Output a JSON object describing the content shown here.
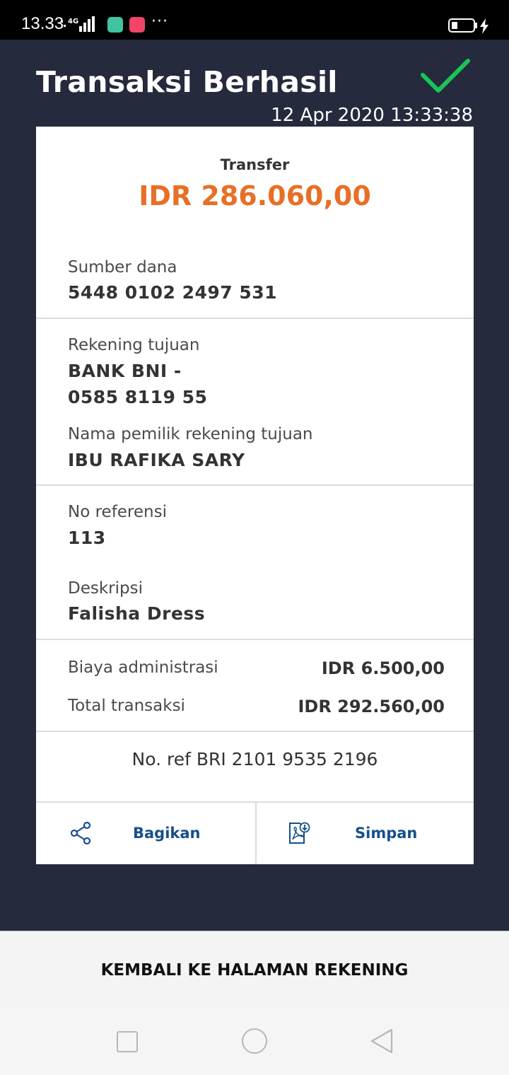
{
  "status_bar": {
    "time": "13.33",
    "network": "4G",
    "icons": [
      "signal-icon",
      "app-notification-icon",
      "app-notification-icon",
      "more-notifications-icon",
      "battery-icon",
      "charging-icon"
    ],
    "more": "···"
  },
  "header": {
    "title": "Transaksi Berhasil",
    "datetime": "12 Apr 2020 13:33:38",
    "status_icon": "check-icon",
    "check_color": "#19c456"
  },
  "receipt": {
    "type": "Transfer",
    "amount": "IDR 286.060,00",
    "amount_color": "#e86f26",
    "source": {
      "label": "Sumber dana",
      "value": "5448 0102 2497 531"
    },
    "destination": {
      "label": "Rekening tujuan",
      "bank": "BANK BNI -",
      "account": "0585 8119 55"
    },
    "owner": {
      "label": "Nama pemilik rekening tujuan",
      "value": "IBU RAFIKA  SARY"
    },
    "reference": {
      "label": "No referensi",
      "value": "113"
    },
    "description": {
      "label": "Deskripsi",
      "value": "Falisha Dress"
    },
    "admin_fee": {
      "label": "Biaya administrasi",
      "value": "IDR 6.500,00"
    },
    "total": {
      "label": "Total transaksi",
      "value": "IDR 292.560,00"
    },
    "bri_ref": "No. ref BRI 2101 9535 2196"
  },
  "actions": {
    "share": {
      "label": "Bagikan",
      "icon": "share-icon"
    },
    "save": {
      "label": "Simpan",
      "icon": "pdf-download-icon"
    },
    "label_color": "#16508a"
  },
  "footer": {
    "back_button": "KEMBALI KE HALAMAN REKENING"
  },
  "nav_bar": {
    "icons": [
      "recents-icon",
      "home-icon",
      "back-icon"
    ]
  }
}
